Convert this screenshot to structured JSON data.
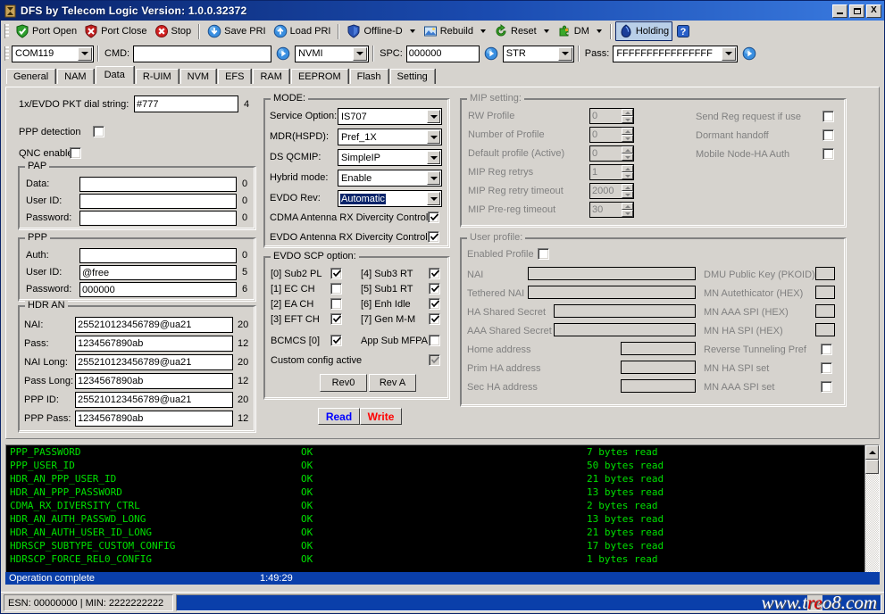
{
  "window": {
    "title": "DFS by Telecom Logic  Version: 1.0.0.32372",
    "minimize_label": "Minimize",
    "maximize_label": "Maximize",
    "close_label": "X"
  },
  "toolbar": {
    "items": [
      {
        "label": "Port Open",
        "icon": "green-shield-check-icon",
        "has_caret": false
      },
      {
        "label": "Port Close",
        "icon": "red-shield-x-icon",
        "has_caret": false
      },
      {
        "label": "Stop",
        "icon": "red-circle-x-icon",
        "has_caret": false
      },
      {
        "label": "Save PRI",
        "icon": "blue-down-arrow-icon",
        "has_caret": false
      },
      {
        "label": "Load PRI",
        "icon": "blue-up-arrow-icon",
        "has_caret": false
      },
      {
        "label": "Offline-D",
        "icon": "blue-shield-icon",
        "has_caret": true
      },
      {
        "label": "Rebuild",
        "icon": "picture-icon",
        "has_caret": true
      },
      {
        "label": "Reset",
        "icon": "green-refresh-icon",
        "has_caret": true
      },
      {
        "label": "DM",
        "icon": "puzzle-icon",
        "has_caret": true
      },
      {
        "label": "Holding",
        "icon": "blue-gem-icon",
        "has_caret": false,
        "pressed": true
      },
      {
        "label": "",
        "icon": "help-question-icon",
        "has_caret": false
      }
    ]
  },
  "cmdbar": {
    "port_value": "COM119",
    "cmd_label": "CMD:",
    "cmd_value": "",
    "send_cmd_icon": "blue-play-icon",
    "mode_value": "NVMI",
    "spc_label": "SPC:",
    "spc_value": "000000",
    "spc_send_icon": "blue-play-icon",
    "str_value": "STR",
    "pass_label": "Pass:",
    "pass_value": "FFFFFFFFFFFFFFFF",
    "pass_send_icon": "blue-play-icon"
  },
  "tabs": [
    {
      "label": "General",
      "active": false
    },
    {
      "label": "NAM",
      "active": false
    },
    {
      "label": "Data",
      "active": true
    },
    {
      "label": "R-UIM",
      "active": false
    },
    {
      "label": "NVM",
      "active": false
    },
    {
      "label": "EFS",
      "active": false
    },
    {
      "label": "RAM",
      "active": false
    },
    {
      "label": "EEPROM",
      "active": false
    },
    {
      "label": "Flash",
      "active": false
    },
    {
      "label": "Setting",
      "active": false
    }
  ],
  "data_tab": {
    "dial": {
      "label": "1x/EVDO PKT dial string:",
      "value": "#777",
      "count": "4"
    },
    "ppp_detection": {
      "label": "PPP detection",
      "checked": false
    },
    "qnc_enabled": {
      "label": "QNC enabled",
      "checked": false
    },
    "pap": {
      "caption": "PAP",
      "rows": [
        {
          "label": "Data:",
          "value": "",
          "count": "0"
        },
        {
          "label": "User ID:",
          "value": "",
          "count": "0"
        },
        {
          "label": "Password:",
          "value": "",
          "count": "0"
        }
      ]
    },
    "ppp": {
      "caption": "PPP",
      "rows": [
        {
          "label": "Auth:",
          "value": "",
          "count": "0"
        },
        {
          "label": "User ID:",
          "value": "@free",
          "count": "5"
        },
        {
          "label": "Password:",
          "value": "000000",
          "count": "6"
        }
      ]
    },
    "hdr_an": {
      "caption": "HDR AN",
      "rows": [
        {
          "label": "NAI:",
          "value": "255210123456789@ua21",
          "count": "20"
        },
        {
          "label": "Pass:",
          "value": "1234567890ab",
          "count": "12"
        },
        {
          "label": "NAI Long:",
          "value": "255210123456789@ua21",
          "count": "20"
        },
        {
          "label": "Pass Long:",
          "value": "1234567890ab",
          "count": "12"
        },
        {
          "label": "PPP ID:",
          "value": "255210123456789@ua21",
          "count": "20"
        },
        {
          "label": "PPP Pass:",
          "value": "1234567890ab",
          "count": "12"
        }
      ]
    },
    "mode": {
      "caption": "MODE:",
      "combos": [
        {
          "label": "Service Option:",
          "value": "IS707",
          "selected": false
        },
        {
          "label": "MDR(HSPD):",
          "value": "Pref_1X",
          "selected": false
        },
        {
          "label": "DS QCMIP:",
          "value": "SimpleIP",
          "selected": false
        },
        {
          "label": "Hybrid mode:",
          "value": "Enable",
          "selected": false
        },
        {
          "label": "EVDO Rev:",
          "value": "Automatic",
          "selected": true
        }
      ],
      "checks": [
        {
          "label": "CDMA Antenna RX Divercity Control",
          "checked": true
        },
        {
          "label": "EVDO Antenna RX Divercity Control",
          "checked": true
        }
      ]
    },
    "evdo_scp": {
      "caption": "EVDO SCP option:",
      "left": [
        {
          "label": "[0] Sub2 PL",
          "checked": true
        },
        {
          "label": "[1] EC CH",
          "checked": false
        },
        {
          "label": "[2] EA CH",
          "checked": false
        },
        {
          "label": "[3] EFT CH",
          "checked": true
        }
      ],
      "right": [
        {
          "label": "[4] Sub3 RT",
          "checked": true
        },
        {
          "label": "[5] Sub1 RT",
          "checked": true
        },
        {
          "label": "[6] Enh Idle",
          "checked": true
        },
        {
          "label": "[7] Gen M-M",
          "checked": true
        }
      ],
      "bcmcs": {
        "label": "BCMCS [0]",
        "checked": true
      },
      "app_sub_mfpa": {
        "label": "App Sub MFPA",
        "checked": false
      },
      "custom_config": {
        "label": "Custom config active",
        "checked": true,
        "disabled": true
      },
      "rev0_button": "Rev0",
      "reva_button": "Rev A"
    },
    "read_button": "Read",
    "write_button": "Write",
    "mip": {
      "caption": "MIP setting:",
      "spinners": [
        {
          "label": "RW Profile",
          "value": "0"
        },
        {
          "label": "Number of Profile",
          "value": "0"
        },
        {
          "label": "Default profile (Active)",
          "value": "0"
        },
        {
          "label": "MIP Reg retrys",
          "value": "1"
        },
        {
          "label": "MIP Reg retry timeout",
          "value": "2000"
        },
        {
          "label": "MIP Pre-reg timeout",
          "value": "30"
        }
      ],
      "checks": [
        {
          "label": "Send Reg request if use",
          "checked": false
        },
        {
          "label": "Dormant handoff",
          "checked": false
        },
        {
          "label": "Mobile Node-HA Auth",
          "checked": false
        }
      ]
    },
    "user_profile": {
      "caption": "User profile:",
      "enabled_profile": {
        "label": "Enabled Profile",
        "checked": false
      },
      "left_fields": [
        {
          "label": "NAI",
          "value": ""
        },
        {
          "label": "Tethered NAI",
          "value": ""
        },
        {
          "label": "HA Shared Secret",
          "value": ""
        },
        {
          "label": "AAA Shared Secret",
          "value": ""
        },
        {
          "label": "Home address",
          "value": ""
        },
        {
          "label": "Prim HA address",
          "value": ""
        },
        {
          "label": "Sec HA address",
          "value": ""
        }
      ],
      "right_fields": [
        {
          "label": "DMU Public Key (PKOID)",
          "value": "",
          "kind": "text"
        },
        {
          "label": "MN Autethicator (HEX)",
          "value": "",
          "kind": "text"
        },
        {
          "label": "MN AAA SPI (HEX)",
          "value": "",
          "kind": "text"
        },
        {
          "label": "MN HA SPI (HEX)",
          "value": "",
          "kind": "text"
        },
        {
          "label": "Reverse Tunneling Pref",
          "checked": false,
          "kind": "check"
        },
        {
          "label": "MN HA SPI set",
          "checked": false,
          "kind": "check"
        },
        {
          "label": "MN AAA SPI set",
          "checked": false,
          "kind": "check"
        }
      ]
    }
  },
  "log": {
    "rows": [
      {
        "name": "PPP_PASSWORD",
        "status": "OK",
        "result": "7 bytes read"
      },
      {
        "name": "PPP_USER_ID",
        "status": "OK",
        "result": "50 bytes read"
      },
      {
        "name": "HDR_AN_PPP_USER_ID",
        "status": "OK",
        "result": "21 bytes read"
      },
      {
        "name": "HDR_AN_PPP_PASSWORD",
        "status": "OK",
        "result": "13 bytes read"
      },
      {
        "name": "CDMA_RX_DIVERSITY_CTRL",
        "status": "OK",
        "result": "2 bytes read"
      },
      {
        "name": "HDR_AN_AUTH_PASSWD_LONG",
        "status": "OK",
        "result": "13 bytes read"
      },
      {
        "name": "HDR_AN_AUTH_USER_ID_LONG",
        "status": "OK",
        "result": "21 bytes read"
      },
      {
        "name": "HDRSCP_SUBTYPE_CUSTOM_CONFIG",
        "status": "OK",
        "result": "17 bytes read"
      },
      {
        "name": "HDRSCP_FORCE_REL0_CONFIG",
        "status": "OK",
        "result": "1 bytes read"
      }
    ],
    "scroll_up_icon": "scroll-up-arrow-icon"
  },
  "status": {
    "message": "Operation complete",
    "time": "1:49:29"
  },
  "bottombar": {
    "esn_min": "ESN:  00000000  |  MIN:  2222222222",
    "watermark_prefix": "www.t",
    "watermark_mid": "re",
    "watermark_suffix": "o8.com"
  },
  "colors": {
    "face": "#d6d3ce",
    "title_start": "#0a246a",
    "accent_blue": "#0a3faa",
    "log_green": "#00e000",
    "read_blue": "#0000ff",
    "write_red": "#ff0000"
  }
}
